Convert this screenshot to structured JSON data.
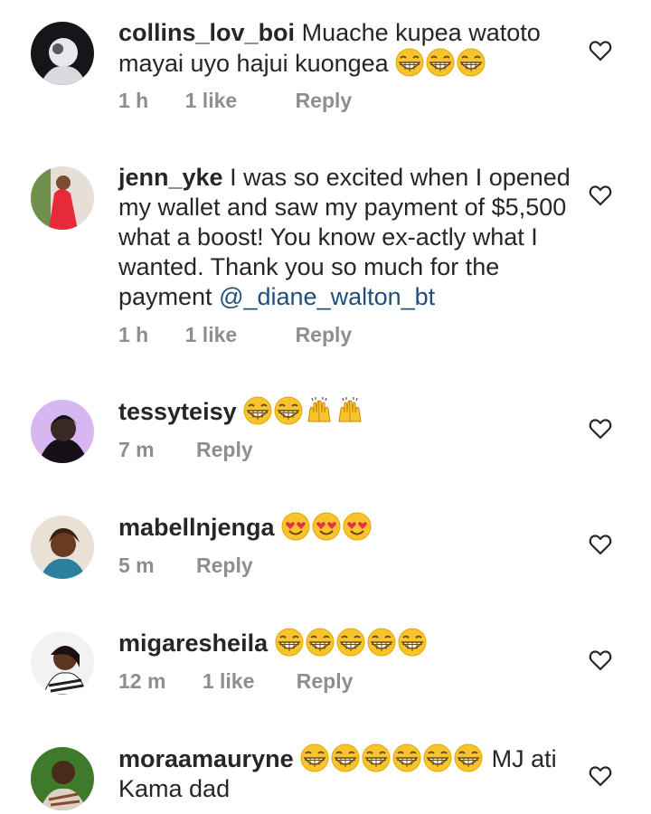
{
  "comments": [
    {
      "username": "collins_lov_boi",
      "text": "Muache kupea watoto mayai uyo hajui kuongea",
      "emojis": [
        "grin",
        "grin",
        "grin"
      ],
      "time": "1 h",
      "likes": "1 like",
      "reply": "Reply"
    },
    {
      "username": "jenn_yke",
      "text": "I was so excited when I opened my wallet and saw my payment of $5,500 what a boost! You know ex-actly what I wanted. Thank you so much for the payment",
      "mention": "@_diane_walton_bt",
      "time": "1 h",
      "likes": "1 like",
      "reply": "Reply"
    },
    {
      "username": "tessyteisy",
      "text": "",
      "emojis": [
        "grin",
        "grin",
        "raised-hands",
        "raised-hands"
      ],
      "time": "7 m",
      "reply": "Reply"
    },
    {
      "username": "mabellnjenga",
      "text": "",
      "emojis": [
        "heart-eyes",
        "heart-eyes",
        "heart-eyes"
      ],
      "time": "5 m",
      "reply": "Reply"
    },
    {
      "username": "migaresheila",
      "text": "",
      "emojis": [
        "grin",
        "grin",
        "grin",
        "grin",
        "grin"
      ],
      "time": "12 m",
      "likes": "1 like",
      "reply": "Reply"
    },
    {
      "username": "moraamauryne",
      "text": "MJ ati Kama dad",
      "emojis": [
        "grin",
        "grin",
        "grin",
        "grin",
        "grin",
        "grin"
      ],
      "reply": ""
    }
  ],
  "colors": {
    "text": "#262626",
    "meta": "#8e8e8e",
    "mention": "#1f4f7a",
    "emoji_face": "#f7c42e"
  }
}
